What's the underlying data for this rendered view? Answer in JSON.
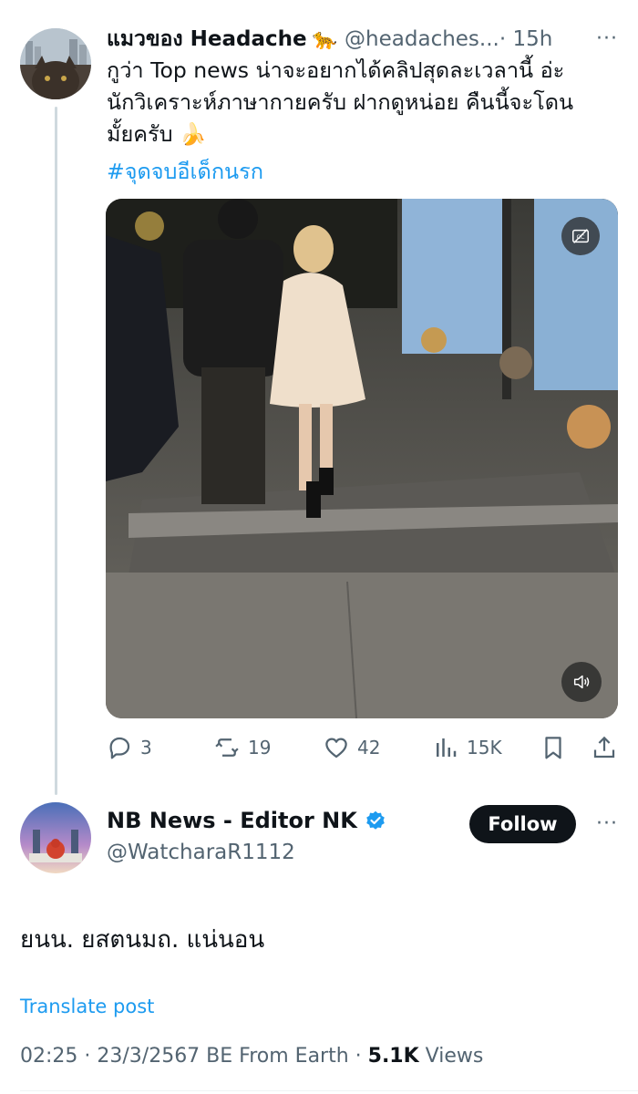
{
  "colors": {
    "accent": "#1d9bf0",
    "text": "#0f1419",
    "muted": "#536471",
    "button_bg": "#0f1419"
  },
  "parent_tweet": {
    "display_name": "แมวของ Headache",
    "name_emoji": "🐆",
    "handle": "@headaches...",
    "time": " · 15h",
    "text": "กูว่า Top news น่าจะอยากได้คลิปสุดละเวลานี้ อ่ะ\nนักวิเคราะห์ภาษากายครับ ฝากดูหน่อย คืนนี้จะโดน\nมั้ยครับ 🍌",
    "hashtag": "#จุดจบอีเด็กนรก",
    "actions": {
      "replies": "3",
      "reposts": "19",
      "likes": "42",
      "views": "15K"
    },
    "icons": [
      "reply-icon",
      "repost-icon",
      "like-icon",
      "views-icon",
      "bookmark-icon",
      "share-icon",
      "captions-off-icon",
      "volume-icon"
    ]
  },
  "reply_tweet": {
    "display_name": "NB News - Editor NK",
    "handle": "@WatcharaR1112",
    "follow_label": "Follow",
    "text": "ยนน. ยสตนมถ. แน่นอน",
    "translate_label": "Translate post",
    "timestamp": "02:25 · 23/3/2567 BE From Earth · ",
    "views_count": "5.1K",
    "views_label": " Views"
  },
  "more_label": "···"
}
